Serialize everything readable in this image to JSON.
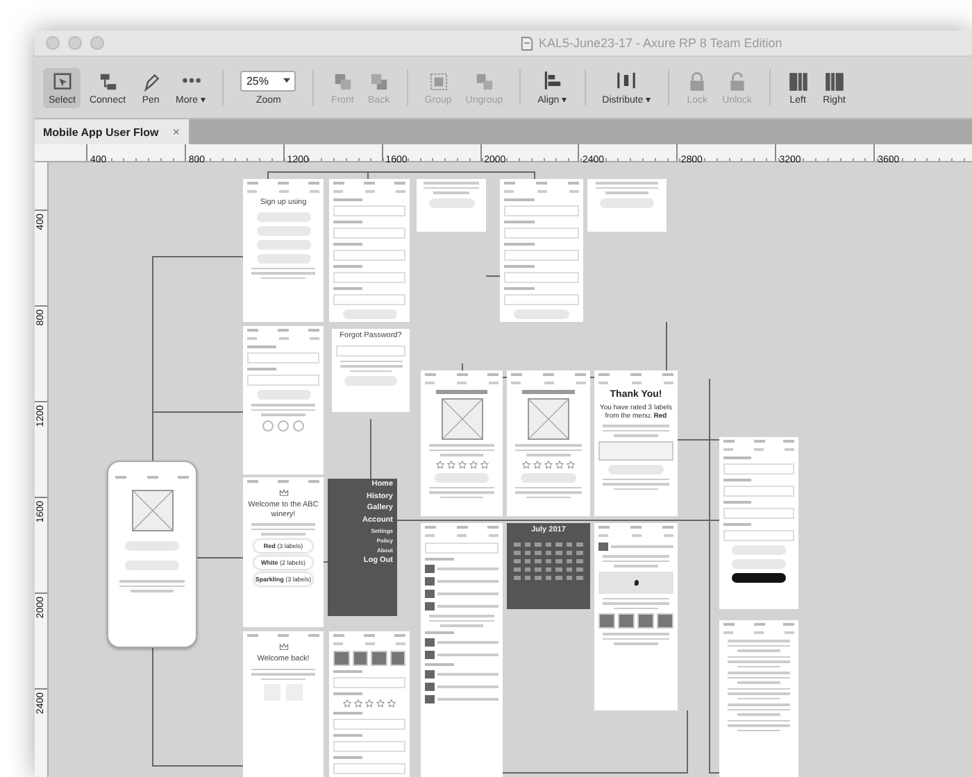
{
  "window": {
    "title": "KAL5-June23-17 - Axure RP 8 Team Edition"
  },
  "toolbar": {
    "tools": [
      {
        "kind": "button",
        "label": "Select",
        "selected": true,
        "disabled": false
      },
      {
        "kind": "button",
        "label": "Connect",
        "selected": false,
        "disabled": false
      },
      {
        "kind": "button",
        "label": "Pen",
        "selected": false,
        "disabled": false
      },
      {
        "kind": "button",
        "label": "More ▾",
        "selected": false,
        "disabled": false
      },
      {
        "kind": "dropdown",
        "label": "Zoom",
        "value": "25%"
      },
      {
        "kind": "button",
        "label": "Front",
        "selected": false,
        "disabled": true
      },
      {
        "kind": "button",
        "label": "Back",
        "selected": false,
        "disabled": true
      },
      {
        "kind": "button",
        "label": "Group",
        "selected": false,
        "disabled": true
      },
      {
        "kind": "button",
        "label": "Ungroup",
        "selected": false,
        "disabled": true
      },
      {
        "kind": "button",
        "label": "Align ▾",
        "selected": false,
        "disabled": false
      },
      {
        "kind": "button",
        "label": "Distribute ▾",
        "selected": false,
        "disabled": false
      },
      {
        "kind": "button",
        "label": "Lock",
        "selected": false,
        "disabled": true
      },
      {
        "kind": "button",
        "label": "Unlock",
        "selected": false,
        "disabled": true
      },
      {
        "kind": "button",
        "label": "Left",
        "selected": false,
        "disabled": false
      },
      {
        "kind": "button",
        "label": "Right",
        "selected": false,
        "disabled": false
      }
    ]
  },
  "tabs": [
    {
      "label": "Mobile App User Flow",
      "close": "×",
      "selected": true
    }
  ],
  "rulers": {
    "horizontal": [
      "400",
      "800",
      "1200",
      "1600",
      "2000",
      "2400",
      "2800",
      "3200",
      "3600"
    ],
    "vertical": [
      "400",
      "800",
      "1200",
      "1600",
      "2000",
      "2400"
    ]
  },
  "screens": [
    {
      "dark": false,
      "blocks": [
        {
          "kind": "status"
        },
        {
          "kind": "nav"
        },
        {
          "kind": "title",
          "text": "Sign up using"
        },
        {
          "kind": "pill"
        },
        {
          "kind": "pill"
        },
        {
          "kind": "pill"
        },
        {
          "kind": "pill"
        },
        {
          "kind": "lines"
        }
      ]
    },
    {
      "dark": false,
      "blocks": [
        {
          "kind": "status"
        },
        {
          "kind": "nav"
        },
        {
          "kind": "label"
        },
        {
          "kind": "field"
        },
        {
          "kind": "label"
        },
        {
          "kind": "field"
        },
        {
          "kind": "label"
        },
        {
          "kind": "field"
        },
        {
          "kind": "label"
        },
        {
          "kind": "field"
        },
        {
          "kind": "label"
        },
        {
          "kind": "field"
        },
        {
          "kind": "pill"
        }
      ]
    },
    {
      "dark": false,
      "blocks": [
        {
          "kind": "lines"
        },
        {
          "kind": "pill"
        }
      ]
    },
    {
      "dark": false,
      "blocks": [
        {
          "kind": "status"
        },
        {
          "kind": "nav"
        },
        {
          "kind": "label"
        },
        {
          "kind": "field"
        },
        {
          "kind": "label"
        },
        {
          "kind": "field"
        },
        {
          "kind": "label"
        },
        {
          "kind": "field"
        },
        {
          "kind": "label"
        },
        {
          "kind": "field"
        },
        {
          "kind": "label"
        },
        {
          "kind": "field"
        },
        {
          "kind": "pill"
        }
      ]
    },
    {
      "dark": false,
      "blocks": [
        {
          "kind": "lines"
        },
        {
          "kind": "pill"
        }
      ]
    },
    {
      "dark": false,
      "blocks": [
        {
          "kind": "status"
        },
        {
          "kind": "nav"
        },
        {
          "kind": "label"
        },
        {
          "kind": "field"
        },
        {
          "kind": "label"
        },
        {
          "kind": "field"
        },
        {
          "kind": "pill"
        },
        {
          "kind": "lines"
        },
        {
          "kind": "social"
        }
      ]
    },
    {
      "dark": false,
      "blocks": [
        {
          "kind": "title",
          "text": "Forgot Password?"
        },
        {
          "kind": "field"
        },
        {
          "kind": "lines"
        },
        {
          "kind": "pill"
        }
      ]
    },
    {
      "dark": false,
      "blocks": [
        {
          "kind": "status"
        },
        {
          "kind": "nav"
        },
        {
          "kind": "heading-bar"
        },
        {
          "kind": "image"
        },
        {
          "kind": "lines"
        },
        {
          "kind": "stars",
          "stars": 0
        },
        {
          "kind": "pill"
        },
        {
          "kind": "lines"
        }
      ]
    },
    {
      "dark": false,
      "blocks": [
        {
          "kind": "status"
        },
        {
          "kind": "nav"
        },
        {
          "kind": "heading-bar"
        },
        {
          "kind": "image"
        },
        {
          "kind": "lines"
        },
        {
          "kind": "stars",
          "stars": 0
        },
        {
          "kind": "pill"
        },
        {
          "kind": "lines"
        }
      ]
    },
    {
      "dark": false,
      "blocks": [
        {
          "kind": "status"
        },
        {
          "kind": "nav"
        },
        {
          "kind": "heading",
          "text": "Thank You!"
        },
        {
          "kind": "text",
          "text": "You have rated 3 labels from the menu: **Red**"
        },
        {
          "kind": "lines"
        },
        {
          "kind": "textarea"
        },
        {
          "kind": "pill"
        },
        {
          "kind": "lines"
        }
      ]
    },
    {
      "dark": false,
      "phone": true,
      "blocks": [
        {
          "kind": "status"
        },
        {
          "kind": "image"
        },
        {
          "kind": "pill"
        },
        {
          "kind": "pill"
        },
        {
          "kind": "lines"
        }
      ]
    },
    {
      "dark": false,
      "blocks": [
        {
          "kind": "status"
        },
        {
          "kind": "logo"
        },
        {
          "kind": "title",
          "text": "Welcome to the ABC winery!"
        },
        {
          "kind": "lines"
        },
        {
          "kind": "option",
          "text": "**Red** (3 labels)"
        },
        {
          "kind": "option",
          "text": "**White** (2 labels)"
        },
        {
          "kind": "option",
          "text": "**Sparkling** (3 labels)"
        }
      ]
    },
    {
      "dark": true,
      "blocks": [
        {
          "kind": "menu-item",
          "text": "Home"
        },
        {
          "kind": "menu-item",
          "text": "History"
        },
        {
          "kind": "menu-item",
          "text": "Gallery"
        },
        {
          "kind": "menu-item",
          "text": "Account"
        },
        {
          "kind": "menu-subitem",
          "text": "Settings"
        },
        {
          "kind": "menu-subitem",
          "text": "Policy"
        },
        {
          "kind": "menu-subitem",
          "text": "About"
        },
        {
          "kind": "menu-item",
          "text": "Log Out"
        }
      ]
    },
    {
      "dark": false,
      "blocks": [
        {
          "kind": "status"
        },
        {
          "kind": "logo"
        },
        {
          "kind": "title",
          "text": "Welcome back!"
        },
        {
          "kind": "lines"
        },
        {
          "kind": "thumbs"
        }
      ]
    },
    {
      "dark": false,
      "blocks": [
        {
          "kind": "status"
        },
        {
          "kind": "nav"
        },
        {
          "kind": "photos"
        },
        {
          "kind": "label"
        },
        {
          "kind": "field"
        },
        {
          "kind": "label"
        },
        {
          "kind": "stars",
          "stars": 0
        },
        {
          "kind": "label"
        },
        {
          "kind": "field"
        },
        {
          "kind": "label"
        },
        {
          "kind": "field"
        },
        {
          "kind": "label"
        },
        {
          "kind": "field"
        }
      ]
    },
    {
      "dark": false,
      "blocks": [
        {
          "kind": "status"
        },
        {
          "kind": "nav"
        },
        {
          "kind": "field"
        },
        {
          "kind": "label"
        },
        {
          "kind": "list-item"
        },
        {
          "kind": "list-item"
        },
        {
          "kind": "list-item"
        },
        {
          "kind": "list-item"
        },
        {
          "kind": "lines"
        },
        {
          "kind": "label"
        },
        {
          "kind": "list-item"
        },
        {
          "kind": "list-item"
        },
        {
          "kind": "label"
        },
        {
          "kind": "list-item"
        },
        {
          "kind": "list-item"
        },
        {
          "kind": "list-item"
        }
      ]
    },
    {
      "dark": true,
      "blocks": [
        {
          "kind": "title",
          "text": "July 2017"
        },
        {
          "kind": "calendar"
        }
      ]
    },
    {
      "dark": false,
      "blocks": [
        {
          "kind": "status"
        },
        {
          "kind": "nav"
        },
        {
          "kind": "list-item"
        },
        {
          "kind": "lines"
        },
        {
          "kind": "map"
        },
        {
          "kind": "lines"
        },
        {
          "kind": "photos"
        },
        {
          "kind": "lines"
        }
      ]
    },
    {
      "dark": false,
      "blocks": [
        {
          "kind": "status"
        },
        {
          "kind": "nav"
        },
        {
          "kind": "label"
        },
        {
          "kind": "field"
        },
        {
          "kind": "label"
        },
        {
          "kind": "field"
        },
        {
          "kind": "label"
        },
        {
          "kind": "field"
        },
        {
          "kind": "label"
        },
        {
          "kind": "field"
        },
        {
          "kind": "pill"
        },
        {
          "kind": "pill"
        },
        {
          "kind": "dark-pill"
        }
      ]
    },
    {
      "dark": false,
      "blocks": [
        {
          "kind": "status"
        },
        {
          "kind": "nav"
        },
        {
          "kind": "lines"
        },
        {
          "kind": "lines"
        },
        {
          "kind": "lines"
        },
        {
          "kind": "lines"
        },
        {
          "kind": "lines"
        },
        {
          "kind": "lines"
        }
      ]
    }
  ]
}
